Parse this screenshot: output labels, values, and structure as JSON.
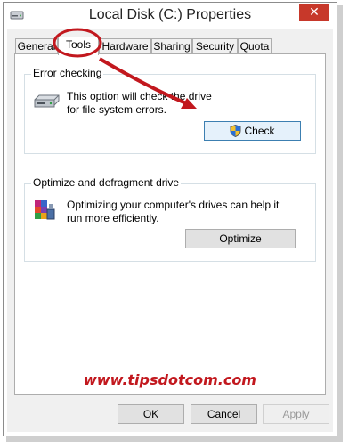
{
  "window": {
    "title": "Local Disk (C:) Properties",
    "close_label": "✕"
  },
  "tabs": [
    {
      "label": "General",
      "active": false
    },
    {
      "label": "Tools",
      "active": true
    },
    {
      "label": "Hardware",
      "active": false
    },
    {
      "label": "Sharing",
      "active": false
    },
    {
      "label": "Security",
      "active": false
    },
    {
      "label": "Quota",
      "active": false
    }
  ],
  "error_checking": {
    "title": "Error checking",
    "description": "This option will check the drive for file system errors.",
    "button_label": "Check"
  },
  "optimize": {
    "title": "Optimize and defragment drive",
    "description": "Optimizing your computer's drives can help it run more efficiently.",
    "button_label": "Optimize"
  },
  "watermark": "www.tipsdotcom.com",
  "footer": {
    "ok_label": "OK",
    "cancel_label": "Cancel",
    "apply_label": "Apply",
    "apply_enabled": false
  },
  "colors": {
    "annotation": "#c2181e",
    "close_button": "#c7382a",
    "focus_border": "#3c7fb1"
  },
  "icons": [
    "drive-icon",
    "defrag-icon",
    "uac-shield-icon",
    "app-drive-icon"
  ]
}
